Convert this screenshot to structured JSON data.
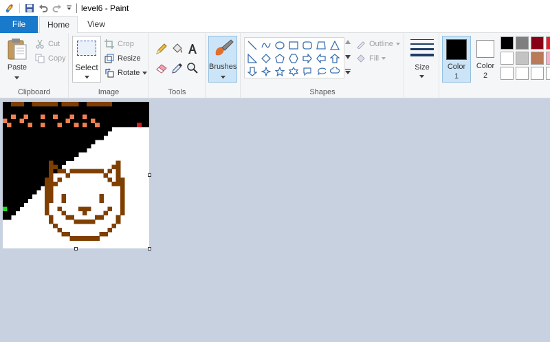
{
  "window": {
    "title": "level6 - Paint"
  },
  "tabs": {
    "file": "File",
    "home": "Home",
    "view": "View"
  },
  "clipboard": {
    "paste": "Paste",
    "cut": "Cut",
    "copy": "Copy",
    "group": "Clipboard"
  },
  "image": {
    "select": "Select",
    "crop": "Crop",
    "resize": "Resize",
    "rotate": "Rotate",
    "group": "Image"
  },
  "tools": {
    "group": "Tools"
  },
  "brushes": {
    "label": "Brushes"
  },
  "shapes": {
    "outline": "Outline",
    "fill": "Fill",
    "group": "Shapes"
  },
  "size": {
    "label": "Size"
  },
  "colors": {
    "color1_label": "Color",
    "color1_num": "1",
    "color2_label": "Color",
    "color2_num": "2",
    "color1_value": "#000000",
    "color2_value": "#ffffff",
    "palette_row1": [
      "#000000",
      "#7f7f7f",
      "#880015",
      "#ed1c24"
    ],
    "palette_row2": [
      "#ffffff",
      "#c3c3c3",
      "#b97a57",
      "#ffaec9"
    ],
    "palette_row3": [
      "#ffffff",
      "#ffffff",
      "#ffffff",
      "#ffffff"
    ]
  },
  "canvas": {
    "colors": {
      "black": "#000000",
      "brown": "#7f3f00",
      "orange": "#f08050",
      "red": "#d02020",
      "green": "#22dd22"
    }
  }
}
